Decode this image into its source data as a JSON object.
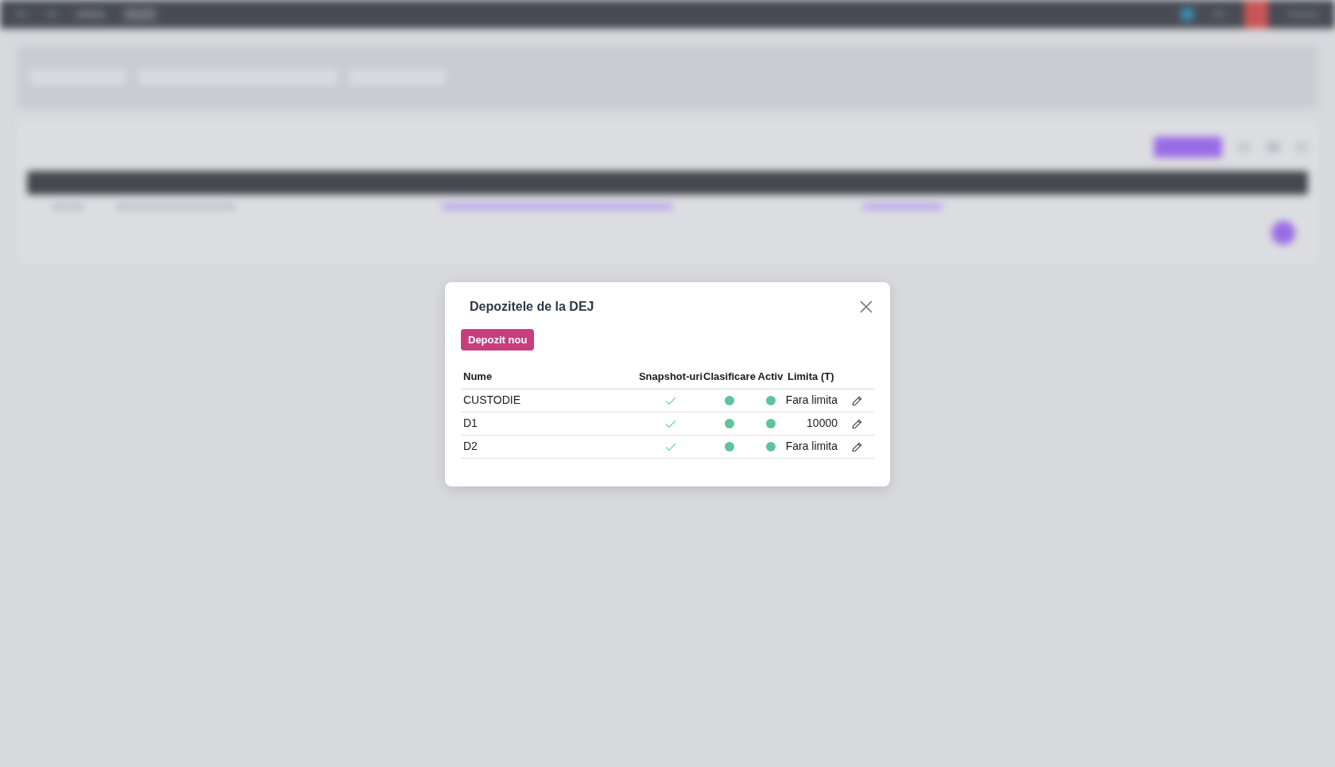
{
  "dialog": {
    "title": "Depozitele de la DEJ",
    "new_button": "Depozit nou",
    "table": {
      "columns": [
        "Nume",
        "Snapshot-uri",
        "Clasificare",
        "Activ",
        "Limita (T)"
      ],
      "rows": [
        {
          "name": "CUSTODIE",
          "snapshots": true,
          "classification": true,
          "active": true,
          "limit": "Fara limita"
        },
        {
          "name": "D1",
          "snapshots": true,
          "classification": true,
          "active": true,
          "limit": "10000"
        },
        {
          "name": "D2",
          "snapshots": true,
          "classification": true,
          "active": true,
          "limit": "Fara limita"
        }
      ]
    }
  }
}
